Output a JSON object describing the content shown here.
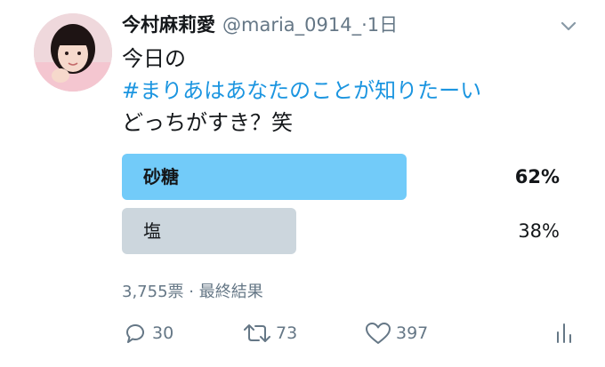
{
  "tweet": {
    "author_name": "今村麻莉愛",
    "handle": "@maria_0914_",
    "separator": " · ",
    "time": "1日",
    "lines": [
      "今日の",
      "#まりあはあなたのことが知りたーい",
      "どっちがすき？笑"
    ]
  },
  "poll": {
    "options": [
      {
        "label": "砂糖",
        "percent_text": "62%",
        "percent": 62,
        "winner": true
      },
      {
        "label": "塩",
        "percent_text": "38%",
        "percent": 38,
        "winner": false
      }
    ],
    "meta": "3,755票 · 最終結果"
  },
  "actions": {
    "reply_count": "30",
    "retweet_count": "73",
    "like_count": "397"
  },
  "colors": {
    "winner_bar": "#72cbf9",
    "other_bar": "#ccd6dd",
    "hashtag": "#1b95e0",
    "muted": "#657786"
  },
  "icons": [
    "chevron-down-icon",
    "reply-icon",
    "retweet-icon",
    "like-icon",
    "analytics-icon"
  ]
}
